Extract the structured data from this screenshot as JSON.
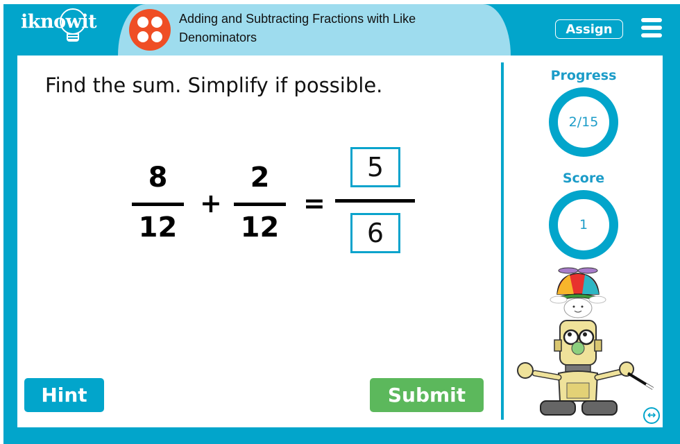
{
  "header": {
    "logo_text": "iknowit",
    "title": "Adding and Subtracting Fractions with Like Denominators",
    "assign_label": "Assign",
    "topic_icon": "four-dots-icon",
    "menu_icon": "hamburger-menu-icon"
  },
  "question": {
    "prompt": "Find the sum. Simplify if possible.",
    "fraction1": {
      "numerator": "8",
      "denominator": "12"
    },
    "operator": "+",
    "fraction2": {
      "numerator": "2",
      "denominator": "12"
    },
    "equals": "=",
    "answer": {
      "numerator": "5",
      "denominator": "6"
    }
  },
  "sidebar": {
    "progress_label": "Progress",
    "progress_value": "2/15",
    "score_label": "Score",
    "score_value": "1",
    "mascot": "robot-magician-mascot",
    "expand_icon": "expand-horizontal-icon"
  },
  "buttons": {
    "hint_label": "Hint",
    "submit_label": "Submit"
  },
  "colors": {
    "frame": "#02a5cb",
    "title_band": "#9edcee",
    "topic_icon": "#ef4e25",
    "submit": "#5cb85c",
    "accent_text": "#1c9cc8"
  }
}
